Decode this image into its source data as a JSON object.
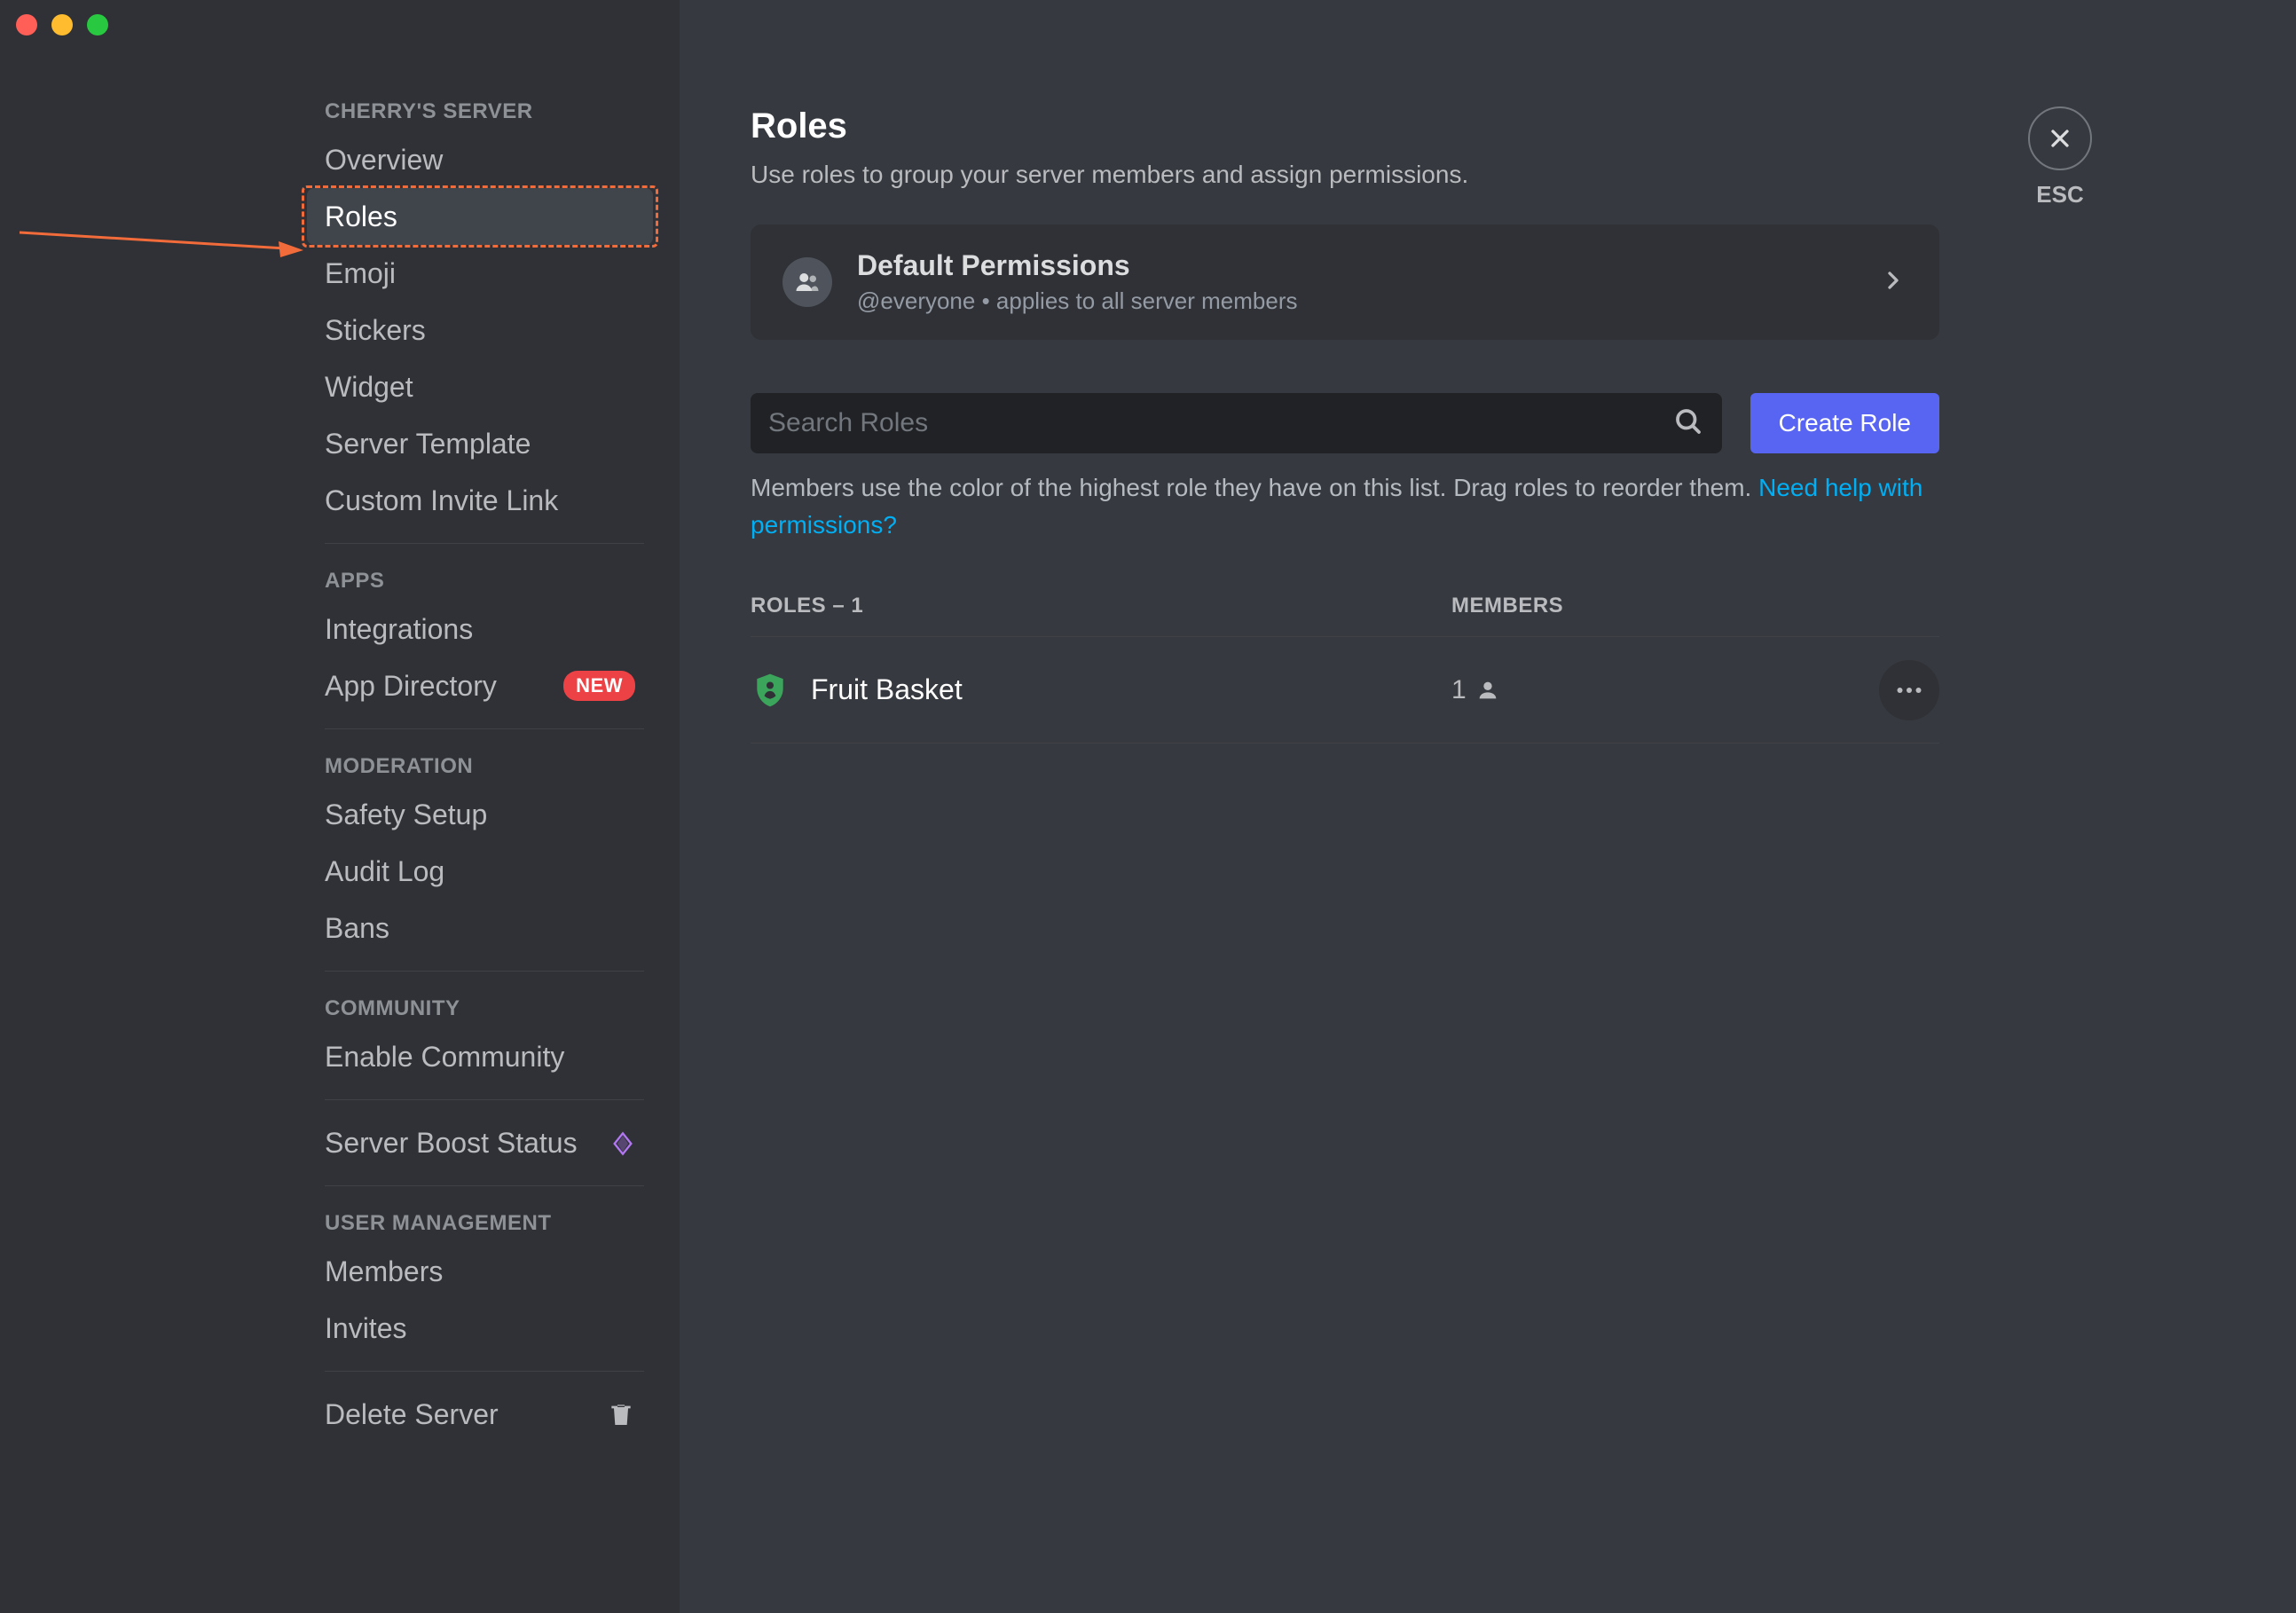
{
  "sidebar": {
    "server_name_header": "CHERRY'S SERVER",
    "items_main": [
      {
        "label": "Overview"
      },
      {
        "label": "Roles",
        "selected": true,
        "highlighted": true
      },
      {
        "label": "Emoji"
      },
      {
        "label": "Stickers"
      },
      {
        "label": "Widget"
      },
      {
        "label": "Server Template"
      },
      {
        "label": "Custom Invite Link"
      }
    ],
    "section_apps": "APPS",
    "items_apps": [
      {
        "label": "Integrations"
      },
      {
        "label": "App Directory",
        "badge": "NEW"
      }
    ],
    "section_moderation": "MODERATION",
    "items_moderation": [
      {
        "label": "Safety Setup"
      },
      {
        "label": "Audit Log"
      },
      {
        "label": "Bans"
      }
    ],
    "section_community": "COMMUNITY",
    "items_community": [
      {
        "label": "Enable Community"
      }
    ],
    "boost_label": "Server Boost Status",
    "section_user_management": "USER MANAGEMENT",
    "items_user_management": [
      {
        "label": "Members"
      },
      {
        "label": "Invites"
      }
    ],
    "delete_label": "Delete Server"
  },
  "close": {
    "esc_label": "ESC"
  },
  "page": {
    "title": "Roles",
    "subtitle": "Use roles to group your server members and assign permissions.",
    "default_permissions": {
      "title": "Default Permissions",
      "subtitle": "@everyone • applies to all server members"
    },
    "search_placeholder": "Search Roles",
    "create_role_label": "Create Role",
    "help_text_prefix": "Members use the color of the highest role they have on this list. Drag roles to reorder them. ",
    "help_link": "Need help with permissions?",
    "roles_count": 1,
    "roles_header_label": "ROLES – 1",
    "members_header_label": "MEMBERS",
    "roles": [
      {
        "name": "Fruit Basket",
        "member_count": "1",
        "color": "#3ba55c"
      }
    ]
  }
}
